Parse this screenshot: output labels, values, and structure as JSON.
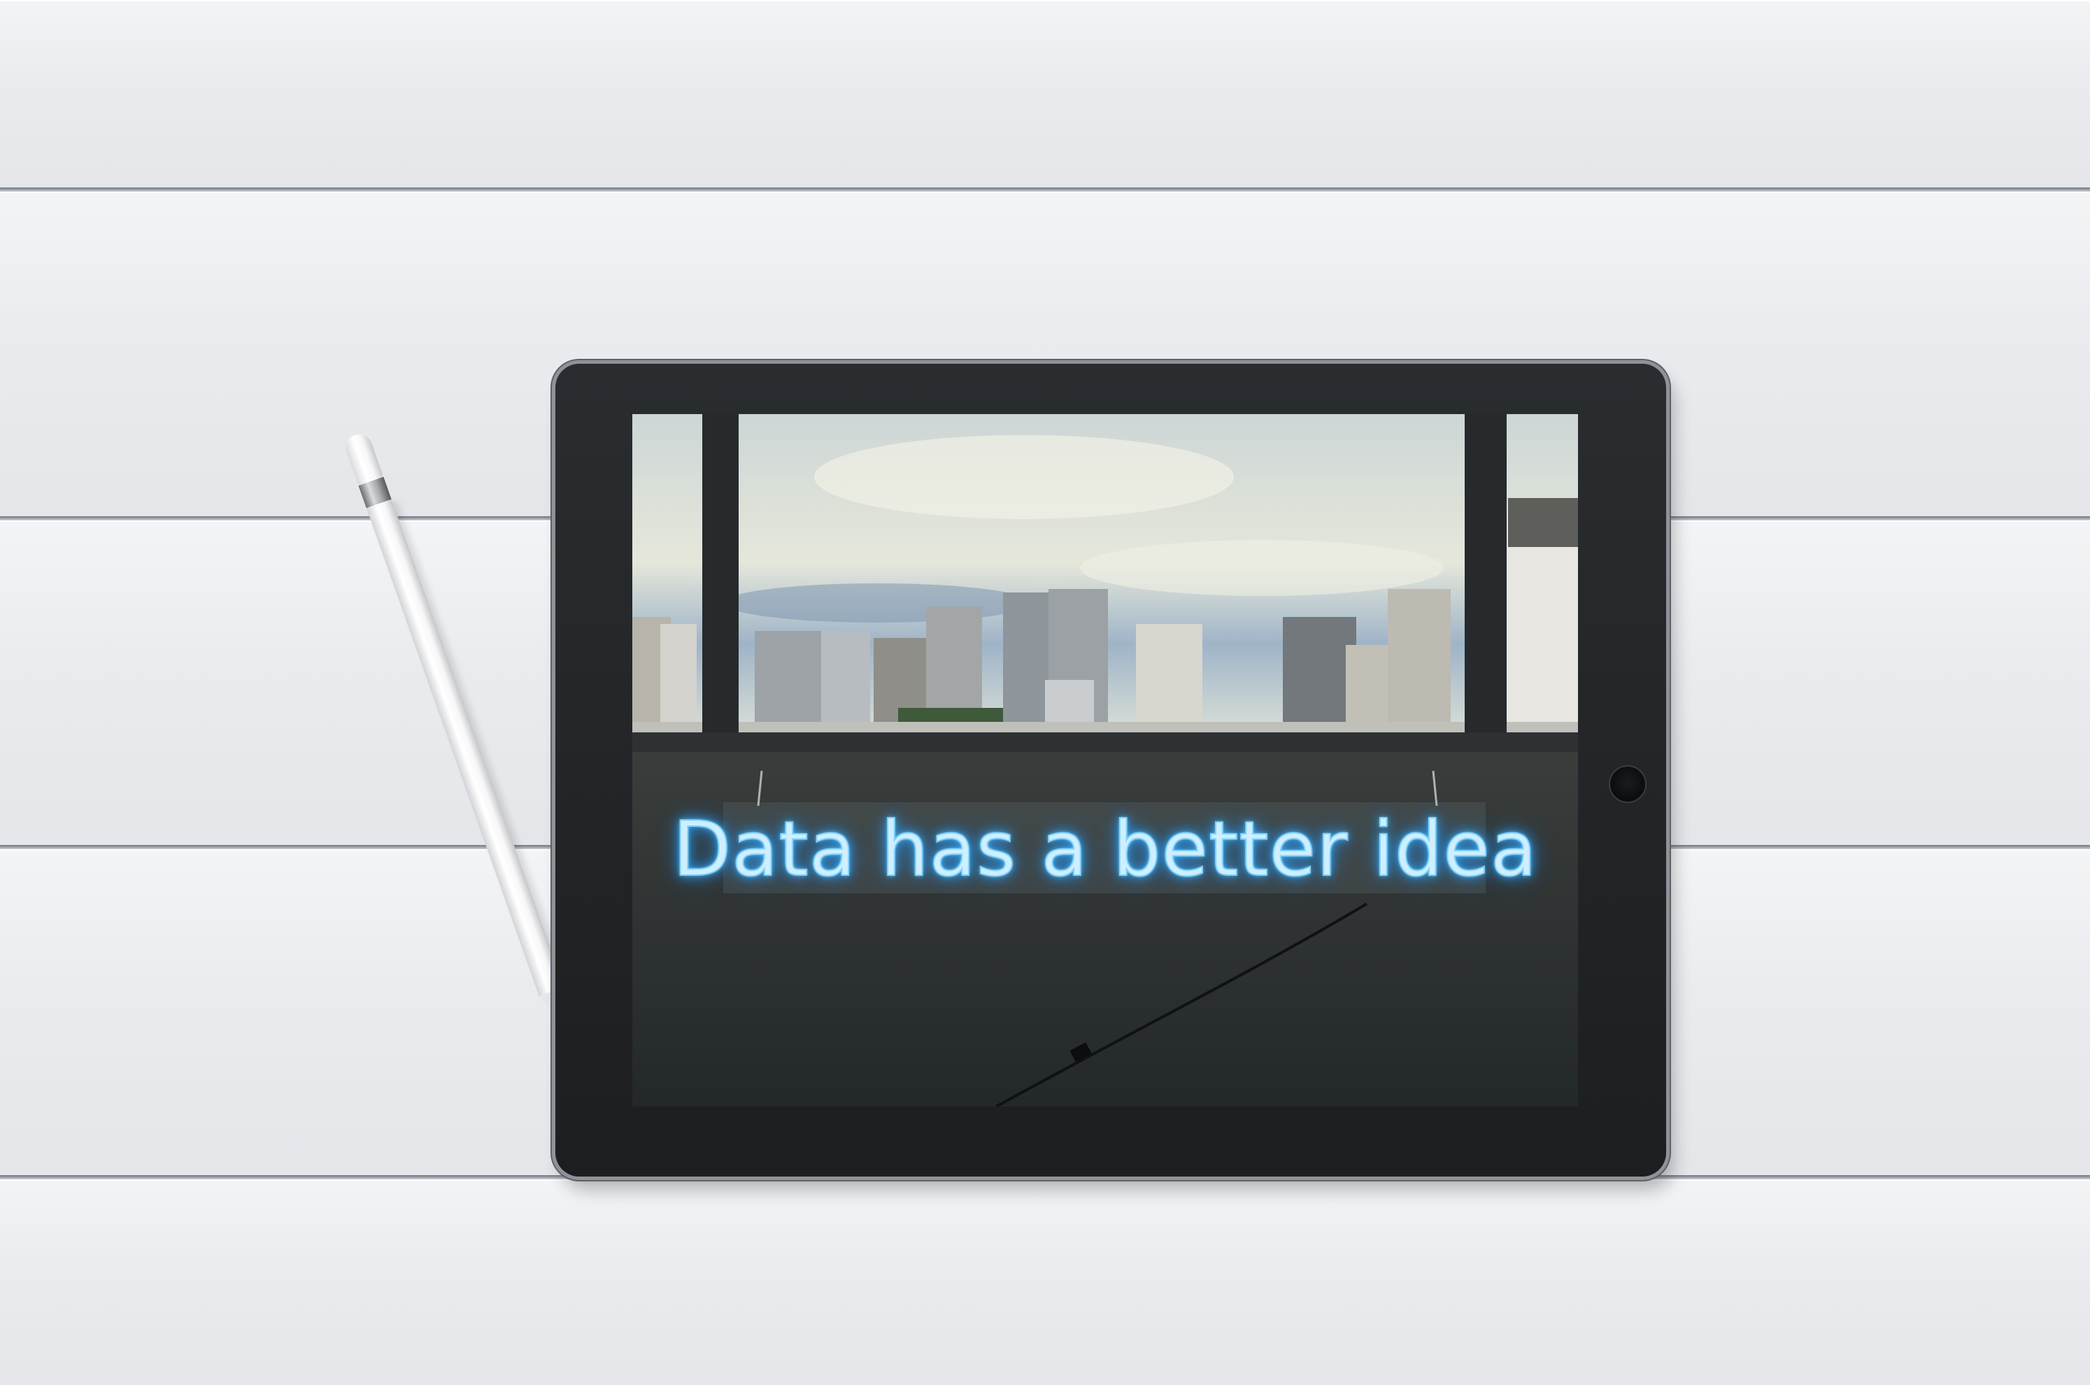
{
  "scene": {
    "neon_sign_text": "Data has a better idea"
  },
  "colors": {
    "background": "#eceef1",
    "tablet_bezel": "#1f2224",
    "neon_glow": "#5ec8ff"
  }
}
